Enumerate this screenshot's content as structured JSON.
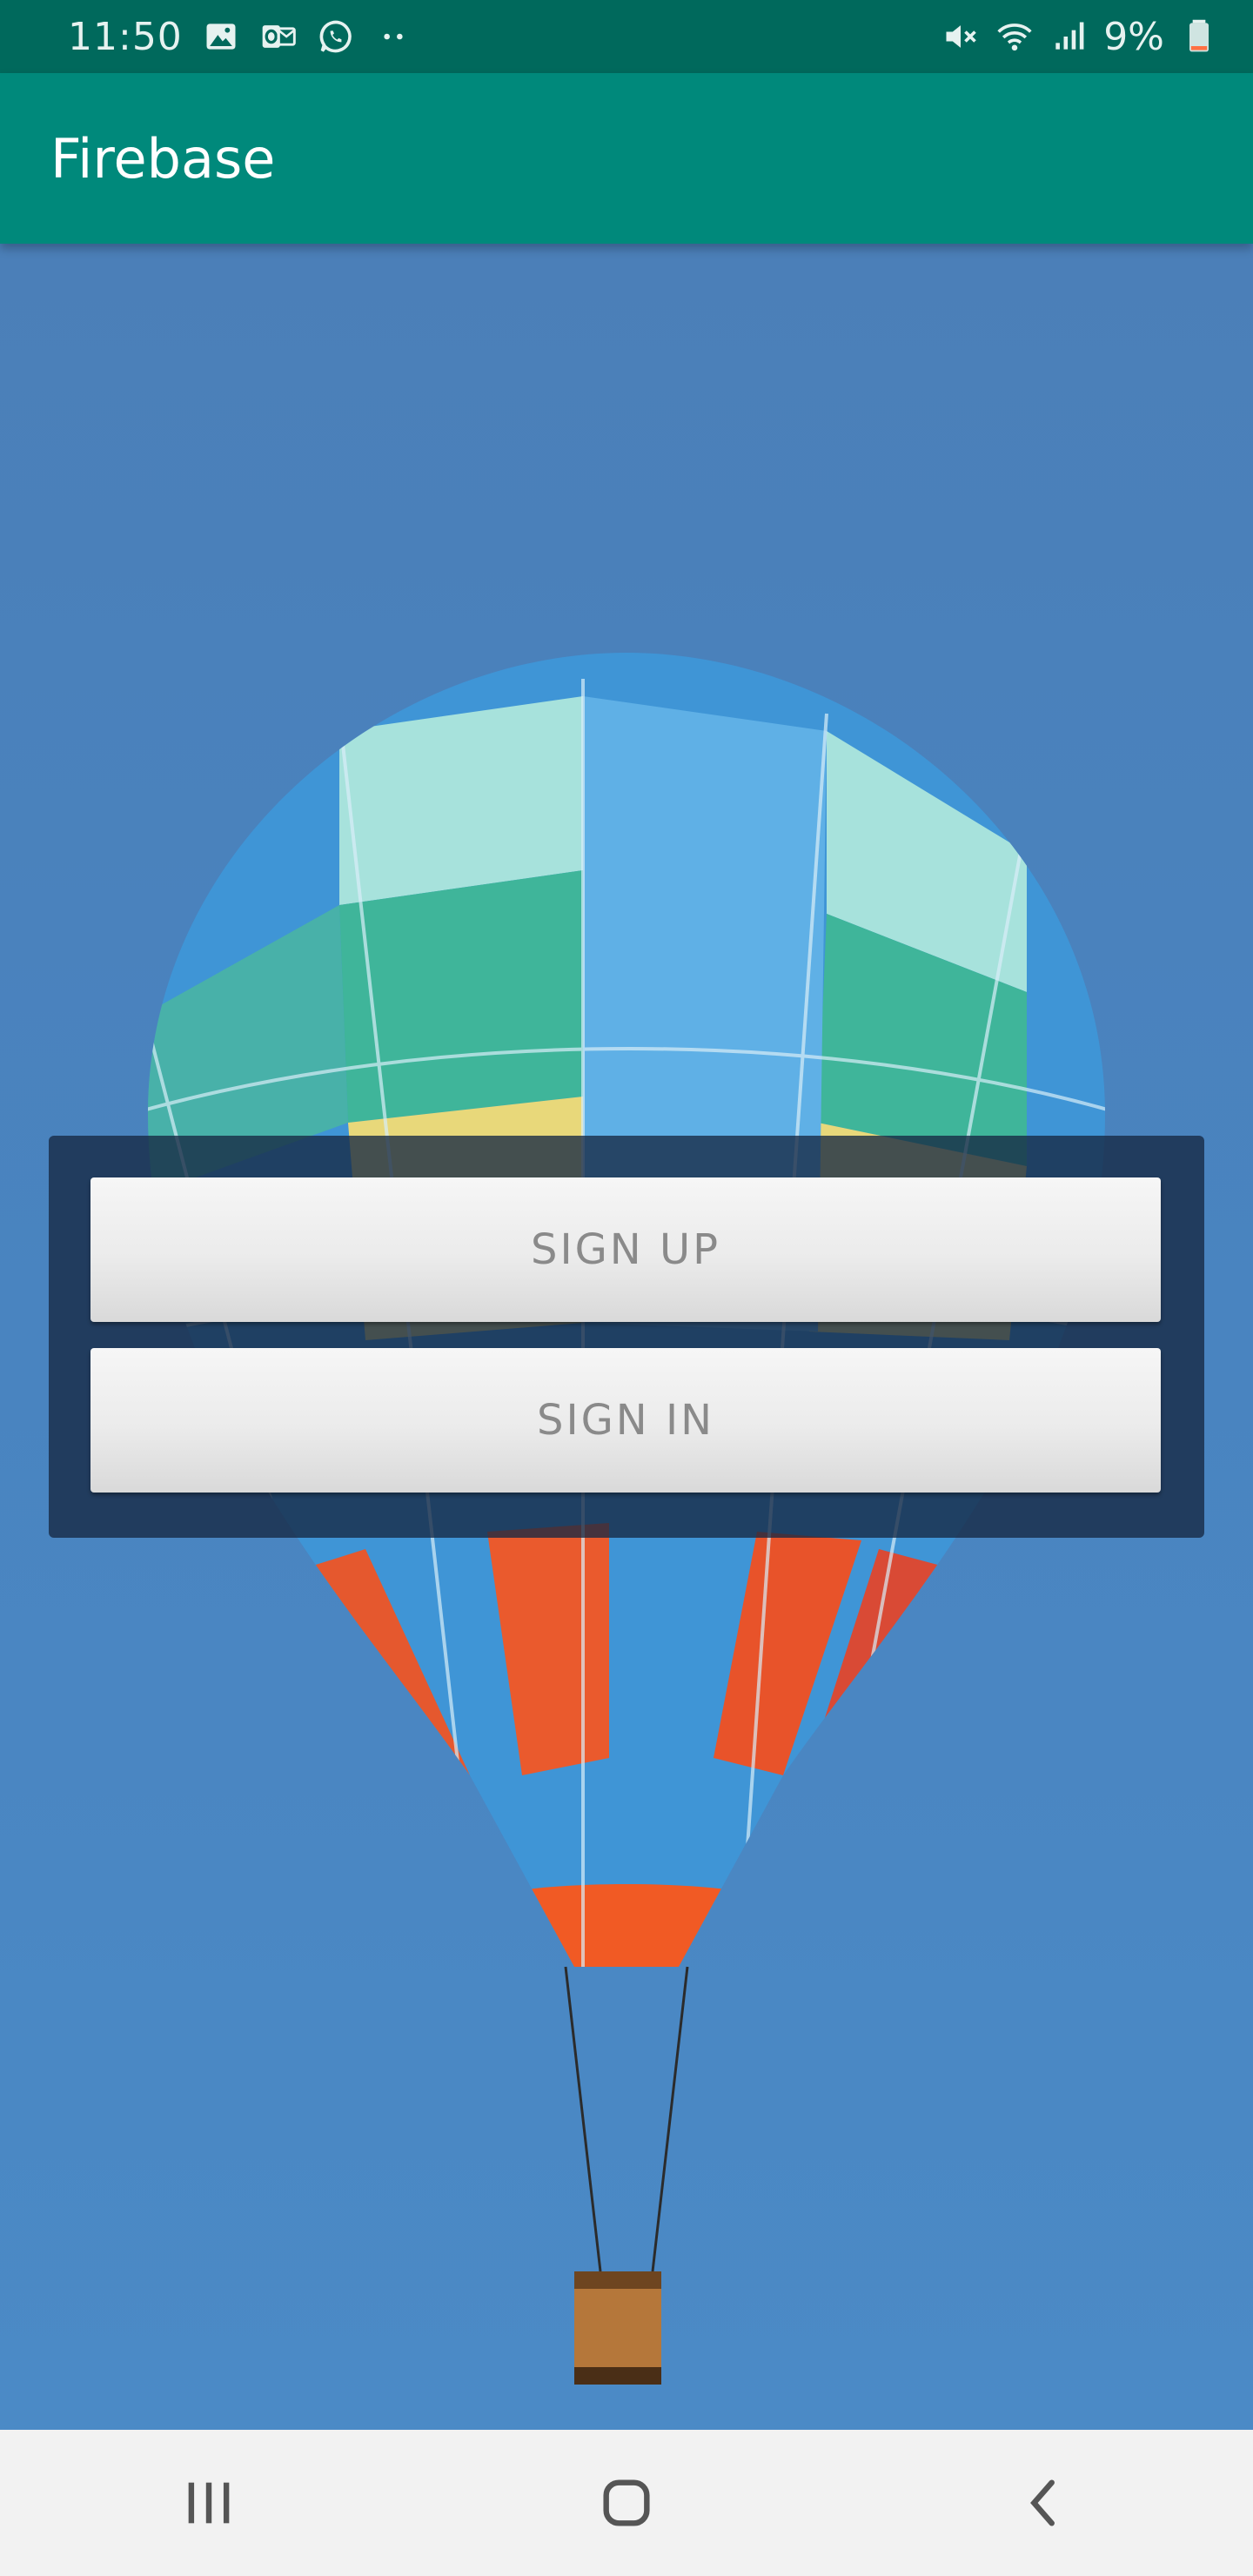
{
  "status_bar": {
    "time": "11:50",
    "left_icons": [
      "image-icon",
      "outlook-icon",
      "whatsapp-icon",
      "more-dots-icon"
    ],
    "right_icons": [
      "mute-icon",
      "wifi-icon",
      "signal-icon"
    ],
    "battery_percent": "9%"
  },
  "app_bar": {
    "title": "Firebase"
  },
  "auth_card": {
    "sign_up_label": "SIGN UP",
    "sign_in_label": "SIGN IN"
  },
  "nav_bar": {
    "buttons": [
      "recent-apps",
      "home",
      "back"
    ]
  },
  "colors": {
    "status_bar": "#00695c",
    "app_bar": "#00897b",
    "sky": "#4a86c2",
    "card": "#162842",
    "button_text": "#8a8a8a"
  }
}
